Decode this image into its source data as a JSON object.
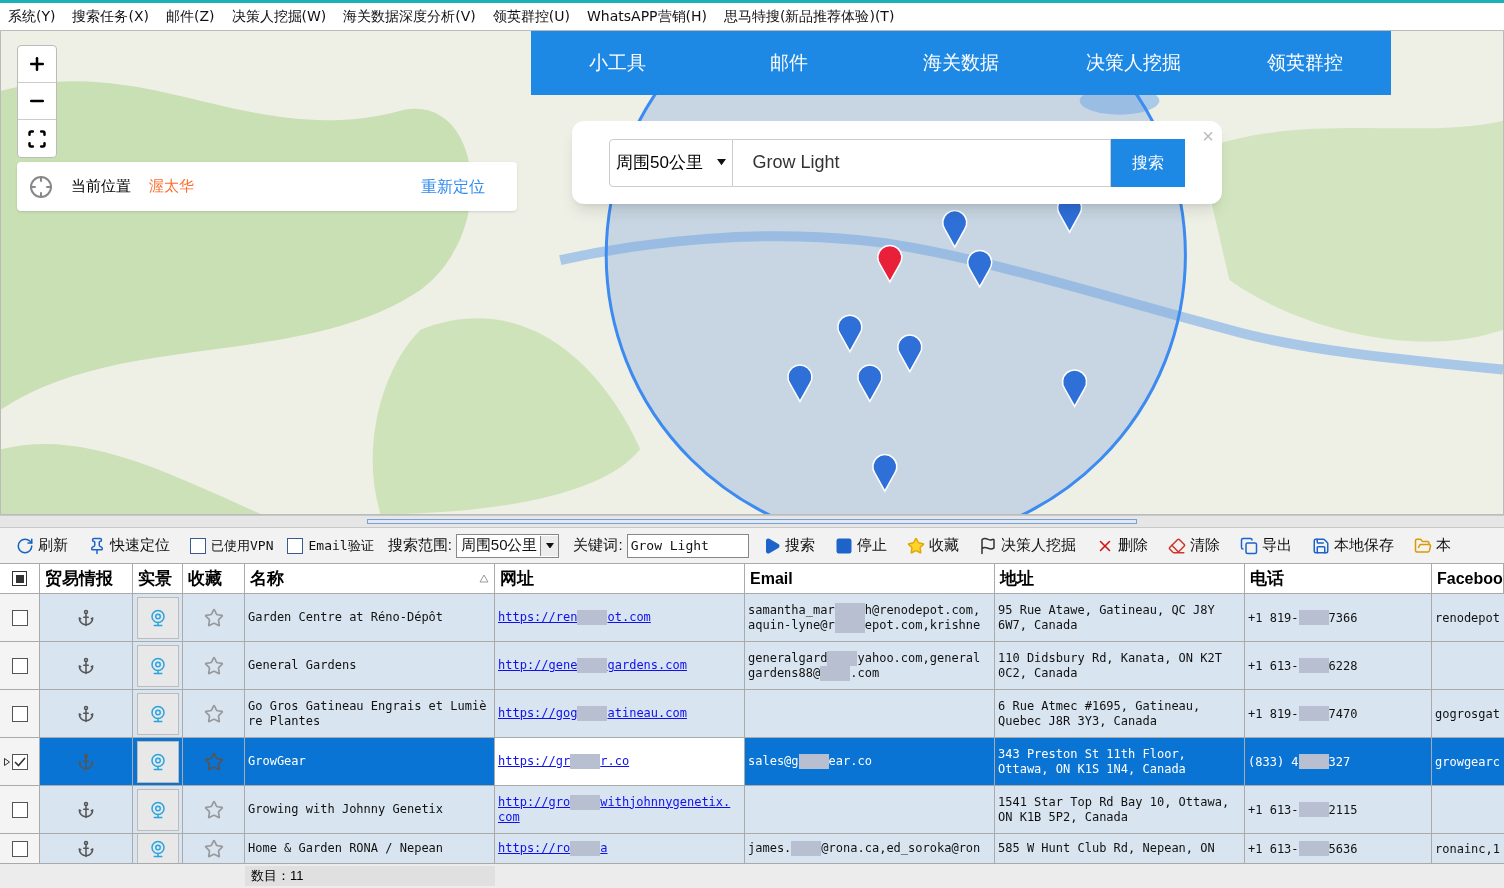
{
  "menu": [
    "系统(Y)",
    "搜索任务(X)",
    "邮件(Z)",
    "决策人挖掘(W)",
    "海关数据深度分析(V)",
    "领英群控(U)",
    "WhatsAPP营销(H)",
    "思马特搜(新品推荐体验)(T)"
  ],
  "nav": [
    "小工具",
    "邮件",
    "海关数据",
    "决策人挖掘",
    "领英群控"
  ],
  "location": {
    "label": "当前位置",
    "city": "渥太华",
    "action": "重新定位"
  },
  "search": {
    "range": "周围50公里",
    "value": "Grow Light",
    "button": "搜索",
    "close": "×"
  },
  "toolbar": [
    {
      "kind": "button",
      "label": "刷新"
    },
    {
      "kind": "button",
      "label": "快速定位"
    },
    {
      "kind": "checkbox",
      "label": "已使用VPN",
      "checked": false
    },
    {
      "kind": "checkbox",
      "label": "Email验证",
      "checked": false
    },
    {
      "kind": "select",
      "label": "搜索范围:",
      "value": "周围50公里"
    },
    {
      "kind": "input",
      "label": "关键词:",
      "value": "Grow Light"
    },
    {
      "kind": "button",
      "label": "搜索"
    },
    {
      "kind": "button",
      "label": "停止"
    },
    {
      "kind": "button",
      "label": "收藏"
    },
    {
      "kind": "button",
      "label": "决策人挖掘"
    },
    {
      "kind": "button",
      "label": "删除"
    },
    {
      "kind": "button",
      "label": "清除"
    },
    {
      "kind": "button",
      "label": "导出"
    },
    {
      "kind": "button",
      "label": "本地保存"
    },
    {
      "kind": "button",
      "label": "本"
    }
  ],
  "table": {
    "columns": [
      "贸易情报",
      "实景",
      "收藏",
      "名称",
      "网址",
      "Email",
      "地址",
      "电话",
      "Faceboo"
    ],
    "rows": [
      {
        "checked": false,
        "selected": false,
        "name": "Garden Centre at Réno-Dépôt",
        "url": [
          [
            "https://ren",
            "ot.com"
          ]
        ],
        "email": [
          [
            "samantha_mar",
            "h@renodepot.com,"
          ],
          [
            "aquin-lyne@r",
            "epot.com,krishne"
          ]
        ],
        "address": "95 Rue Atawe, Gatineau, QC J8Y 6W7, Canada",
        "phone": [
          "+1 819-",
          "7366"
        ],
        "facebook": "renodepot"
      },
      {
        "checked": false,
        "selected": false,
        "name": "General Gardens",
        "url": [
          [
            "http://gene",
            "gardens.com"
          ]
        ],
        "email": [
          [
            "generalgard",
            "yahoo.com,general"
          ],
          [
            "gardens88@",
            ".com"
          ]
        ],
        "address": "110 Didsbury Rd, Kanata, ON K2T 0C2, Canada",
        "phone": [
          "+1 613-",
          "6228"
        ]
      },
      {
        "checked": false,
        "selected": false,
        "name": "Go Gros Gatineau Engrais et Lumière Plantes",
        "url": [
          [
            "https://gog",
            "atineau.com"
          ]
        ],
        "address": "6 Rue Atmec #1695, Gatineau, Quebec J8R 3Y3, Canada",
        "phone": [
          "+1 819-",
          "7470"
        ],
        "facebook": "gogrosgat"
      },
      {
        "checked": true,
        "selected": true,
        "name": "GrowGear",
        "url": [
          [
            "https://gr",
            "r.co"
          ]
        ],
        "email": [
          [
            "sales@g",
            "ear.co"
          ]
        ],
        "address": "343 Preston St 11th Floor, Ottawa, ON K1S 1N4, Canada",
        "phone": [
          "(833) 4",
          "327"
        ],
        "facebook": "growgearc"
      },
      {
        "checked": false,
        "selected": false,
        "name": "Growing with Johnny Genetix",
        "url": [
          [
            "http://gro",
            "withjohnnygenetix."
          ],
          [
            "com"
          ]
        ],
        "address": "1541 Star Top Rd Bay 10, Ottawa, ON K1B 5P2, Canada",
        "phone": [
          "+1 613-",
          "2115"
        ]
      },
      {
        "checked": false,
        "selected": false,
        "name": "Home & Garden RONA / Nepean",
        "url": [
          [
            "https://ro",
            "a"
          ]
        ],
        "email": [
          [
            "james.",
            "@rona.ca,ed_soroka@ron"
          ]
        ],
        "address": "585 W Hunt Club Rd, Nepean, ON",
        "phone": [
          "+1 613-",
          "5636"
        ],
        "facebook": "ronainc,1"
      }
    ]
  },
  "footer": "数目：11"
}
